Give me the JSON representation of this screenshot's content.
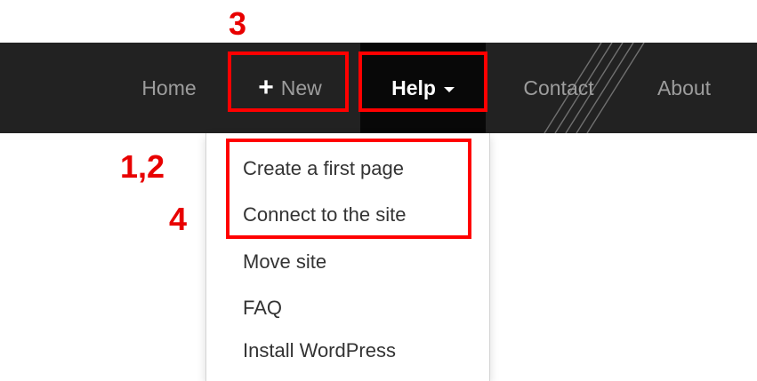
{
  "navbar": {
    "items": {
      "home": {
        "label": "Home"
      },
      "new": {
        "icon": "plus-icon",
        "plus_glyph": "+",
        "label": "New"
      },
      "help": {
        "label": "Help",
        "icon": "caret-down-icon"
      },
      "contact": {
        "label": "Contact"
      },
      "about": {
        "label": "About"
      }
    }
  },
  "help_menu": {
    "items": [
      {
        "label": "Create a first page"
      },
      {
        "label": "Connect to the site"
      },
      {
        "label": "Move site"
      },
      {
        "label": "FAQ"
      },
      {
        "label": "Install WordPress"
      }
    ]
  },
  "annotations": {
    "step_new": "3",
    "step_first_page": "1,2",
    "step_connect": "4",
    "color": "#ff0000"
  }
}
